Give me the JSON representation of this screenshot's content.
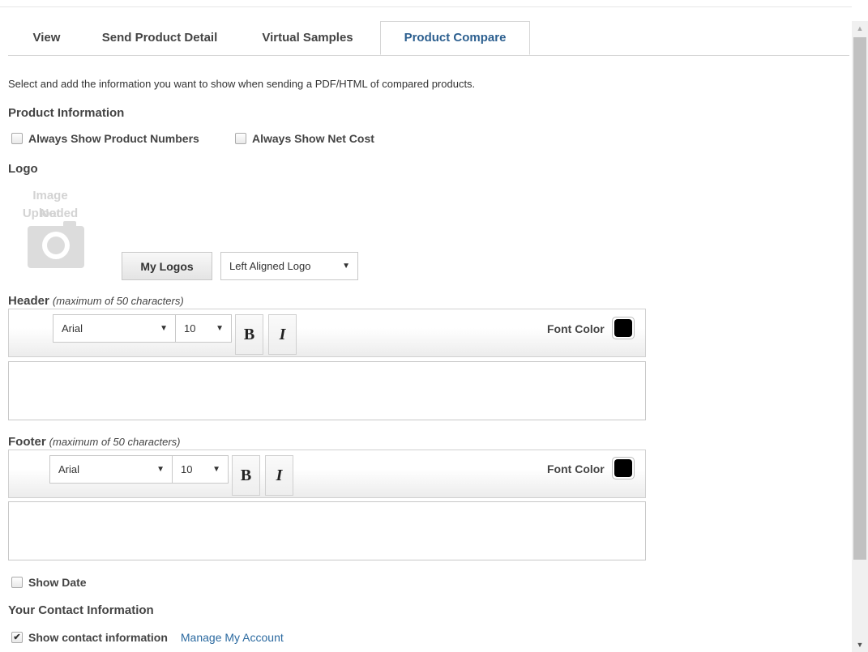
{
  "tabs": [
    {
      "label": "View"
    },
    {
      "label": "Send Product Detail"
    },
    {
      "label": "Virtual Samples"
    },
    {
      "label": "Product Compare"
    }
  ],
  "intro_text": "Select and add the information you want to show when sending a PDF/HTML of compared products.",
  "product_info": {
    "title": "Product Information",
    "always_show_numbers": "Always Show Product Numbers",
    "always_show_net_cost": "Always Show Net Cost"
  },
  "logo": {
    "title": "Logo",
    "placeholder_line1": "Image Not",
    "placeholder_line2": "Uploaded",
    "my_logos_label": "My Logos",
    "alignment_value": "Left Aligned Logo"
  },
  "header": {
    "label": "Header",
    "note": "(maximum of 50 characters)",
    "font": "Arial",
    "size": "10",
    "bold": "B",
    "italic": "I",
    "font_color_label": "Font Color",
    "color": "#000000"
  },
  "footer": {
    "label": "Footer",
    "note": "(maximum of 50 characters)",
    "font": "Arial",
    "size": "10",
    "bold": "B",
    "italic": "I",
    "font_color_label": "Font Color",
    "color": "#000000"
  },
  "show_date": {
    "label": "Show Date",
    "checked": false
  },
  "contact": {
    "title": "Your Contact Information",
    "show_label": "Show contact information",
    "checked": true,
    "manage_link": "Manage My Account"
  },
  "icons": {
    "check": "✔",
    "dropdown": "▼",
    "scroll_up": "▲",
    "scroll_down": "▼"
  }
}
